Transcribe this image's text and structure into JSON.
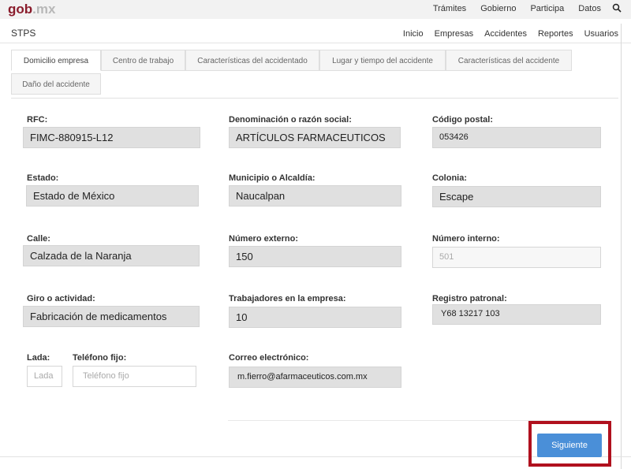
{
  "header": {
    "logo_main": "gob",
    "logo_suffix": ".mx",
    "nav": [
      "Trámites",
      "Gobierno",
      "Participa",
      "Datos"
    ]
  },
  "subheader": {
    "brand": "STPS",
    "nav": [
      "Inicio",
      "Empresas",
      "Accidentes",
      "Reportes",
      "Usuarios"
    ]
  },
  "tabs": [
    "Domicilio empresa",
    "Centro de trabajo",
    "Características del accidentado",
    "Lugar y tiempo del accidente",
    "Características del accidente",
    "Daño del accidente"
  ],
  "form": {
    "rfc": {
      "label": "RFC:",
      "value": "FIMC-880915-L12"
    },
    "razon_social": {
      "label": "Denominación o razón social:",
      "value": "ARTÍCULOS FARMACEUTICOS"
    },
    "codigo_postal": {
      "label": "Código postal:",
      "value": "053426"
    },
    "estado": {
      "label": "Estado:",
      "value": "Estado de México"
    },
    "municipio": {
      "label": "Municipio o Alcaldía:",
      "value": "Naucalpan"
    },
    "colonia": {
      "label": "Colonia:",
      "value": "Escape"
    },
    "calle": {
      "label": "Calle:",
      "value": "Calzada de la Naranja"
    },
    "numero_externo": {
      "label": "Número externo:",
      "value": "150"
    },
    "numero_interno": {
      "label": "Número interno:",
      "value": "501"
    },
    "giro": {
      "label": "Giro o actividad:",
      "value": "Fabricación de medicamentos"
    },
    "trabajadores": {
      "label": "Trabajadores en la empresa:",
      "value": "10"
    },
    "registro_patronal": {
      "label": "Registro patronal:",
      "value": "Y68 13217 103"
    },
    "lada": {
      "label": "Lada:",
      "placeholder": "Lada"
    },
    "telefono": {
      "label": "Teléfono fijo:",
      "placeholder": "Teléfono fijo"
    },
    "correo": {
      "label": "Correo electrónico:",
      "value": "m.fierro@afarmaceuticos.com.mx"
    }
  },
  "actions": {
    "next_label": "Siguiente"
  },
  "colors": {
    "brand": "#8a1c2c",
    "primary_button": "#4a8fd8",
    "highlight": "#b0101e"
  }
}
